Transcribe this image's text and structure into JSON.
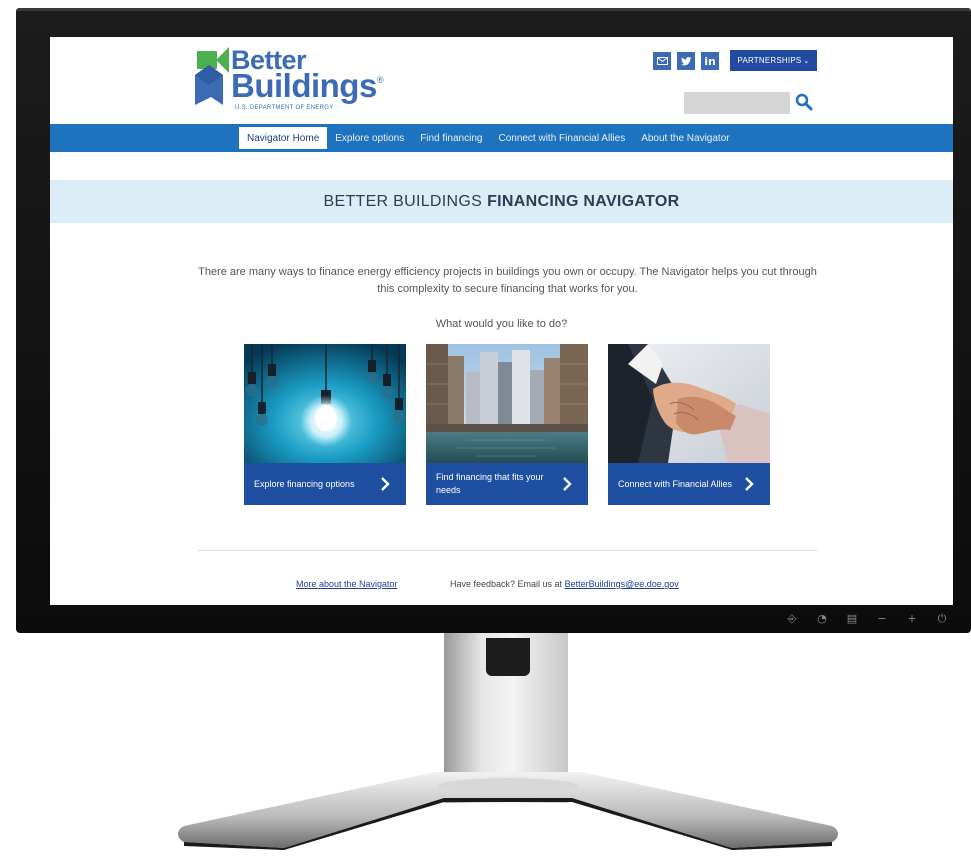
{
  "header": {
    "logo_line1": "Better",
    "logo_line2": "Buildings",
    "logo_subtitle": "U.S. DEPARTMENT OF ENERGY",
    "social_icons": [
      "email-icon",
      "twitter-icon",
      "linkedin-icon"
    ],
    "linkedin_glyph": "in",
    "partnerships_label": "PARTNERSHIPS",
    "search_placeholder": ""
  },
  "nav": {
    "items": [
      {
        "label": "Navigator Home",
        "active": true
      },
      {
        "label": "Explore options",
        "active": false
      },
      {
        "label": "Find financing",
        "active": false
      },
      {
        "label": "Connect with Financial Allies",
        "active": false
      },
      {
        "label": "About the Navigator",
        "active": false
      }
    ]
  },
  "main": {
    "title_light": "BETTER BUILDINGS",
    "title_bold": "FINANCING NAVIGATOR",
    "intro": "There are many ways to finance energy efficiency projects in buildings you own or occupy. The Navigator helps you cut through this complexity to secure financing that works for you.",
    "question": "What would you like to do?",
    "cards": [
      {
        "label": "Explore financing options",
        "image": "lightbulbs"
      },
      {
        "label": "Find financing that fits your needs",
        "image": "city-skyline"
      },
      {
        "label": "Connect with Financial Allies",
        "image": "handshake"
      }
    ]
  },
  "footer": {
    "more_link": "More about the Navigator",
    "feedback_text": "Have feedback? Email us at",
    "email_link": "BetterBuildings@ee.doe.gov"
  },
  "colors": {
    "brand_blue": "#3b6bb5",
    "nav_blue": "#1e73be",
    "card_blue": "#1f4fa0",
    "title_band": "#dcedf8",
    "logo_green": "#4caf50"
  }
}
